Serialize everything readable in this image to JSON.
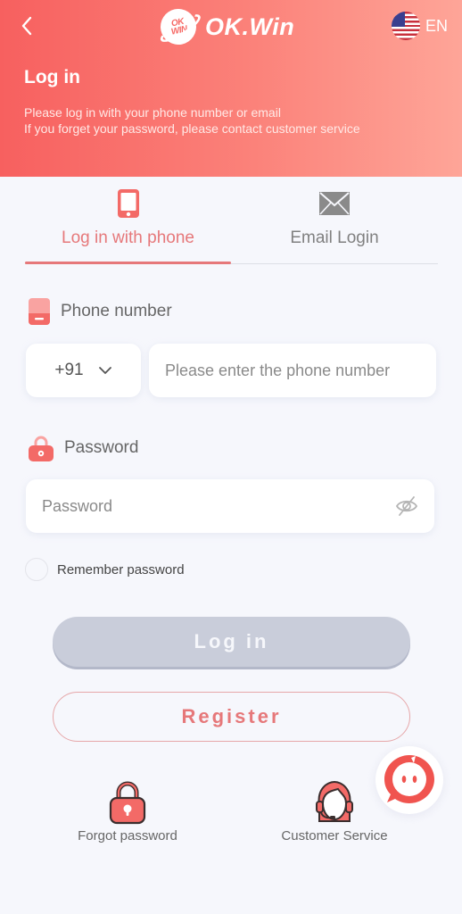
{
  "header": {
    "back_icon": "chevron-left-icon",
    "logo_badge_line1": "OK",
    "logo_badge_line2": "WIN",
    "logo_text": "OK.Win",
    "language": {
      "flag": "us-flag-icon",
      "label": "EN"
    },
    "title": "Log in",
    "description_line1": "Please log in with your phone number or email",
    "description_line2": "If you forget your password, please contact customer service"
  },
  "tabs": [
    {
      "label": "Log in with phone",
      "icon": "smartphone-icon",
      "active": true
    },
    {
      "label": "Email Login",
      "icon": "envelope-icon",
      "active": false
    }
  ],
  "phone": {
    "label": "Phone number",
    "icon": "phone-card-icon",
    "country_code": "+91",
    "placeholder": "Please enter the phone number",
    "value": ""
  },
  "password": {
    "label": "Password",
    "icon": "lock-icon",
    "placeholder": "Password",
    "value": "",
    "visibility_icon": "eye-off-icon"
  },
  "remember": {
    "label": "Remember password",
    "checked": false
  },
  "buttons": {
    "login": "Log in",
    "register": "Register"
  },
  "links": [
    {
      "label": "Forgot password",
      "icon": "padlock-icon"
    },
    {
      "label": "Customer Service",
      "icon": "headset-agent-icon"
    }
  ],
  "colors": {
    "accent": "#e6787a",
    "header_start": "#f7605f",
    "header_end": "#fea598",
    "login_disabled": "#c9cdda",
    "background": "#f6f7fc"
  }
}
